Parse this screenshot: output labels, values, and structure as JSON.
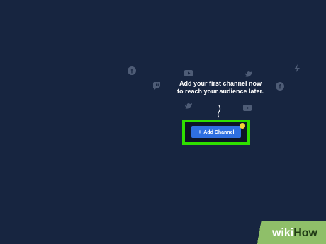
{
  "headline": {
    "line1": "Add your first channel now",
    "line2": "to reach your audience later."
  },
  "button": {
    "label": "Add Channel",
    "icon": "plus-icon"
  },
  "icons": [
    "facebook-icon",
    "youtube-icon",
    "twitter-icon",
    "twitch-icon",
    "lightning-icon",
    "facebook-icon",
    "twitter-icon",
    "youtube-icon"
  ],
  "colors": {
    "background": "#172540",
    "accent_blue": "#2f6fe0",
    "highlight_green": "#2fe000",
    "notification_yellow": "#f2d338"
  },
  "watermark": {
    "part1": "wiki",
    "part2": "How"
  }
}
